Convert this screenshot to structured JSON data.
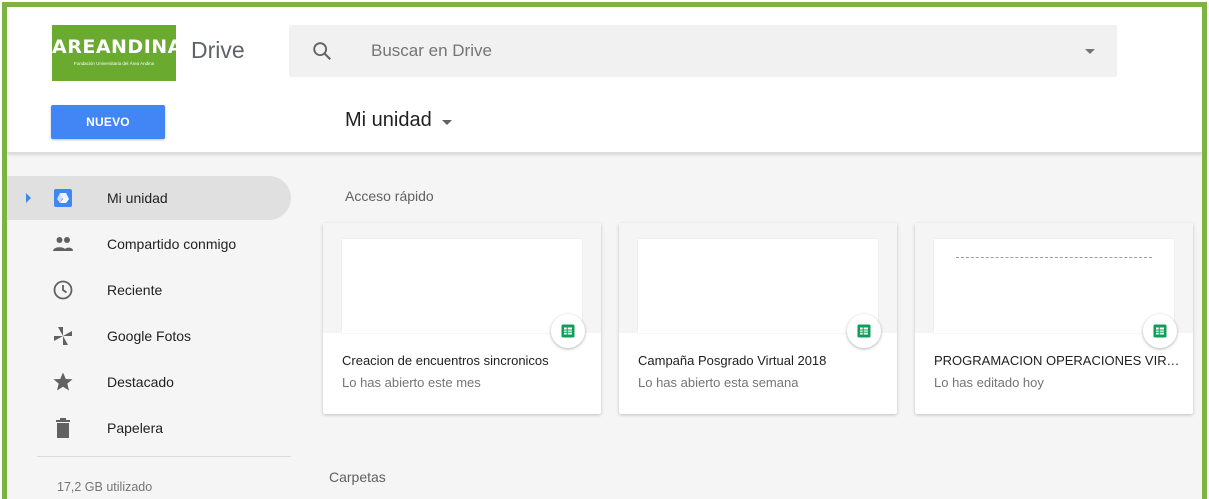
{
  "header": {
    "logo_text": "AREANDINA",
    "logo_subtext": "Fundación Universitaria del Área Andina",
    "app_title": "Drive",
    "search_placeholder": "Buscar en Drive",
    "new_button": "NUEVO",
    "location": "Mi unidad"
  },
  "sidebar": {
    "items": [
      {
        "label": "Mi unidad",
        "icon": "drive-icon",
        "active": true
      },
      {
        "label": "Compartido conmigo",
        "icon": "people-icon"
      },
      {
        "label": "Reciente",
        "icon": "clock-icon"
      },
      {
        "label": "Google Fotos",
        "icon": "pinwheel-icon"
      },
      {
        "label": "Destacado",
        "icon": "star-icon"
      },
      {
        "label": "Papelera",
        "icon": "trash-icon"
      }
    ],
    "storage": "17,2 GB utilizado"
  },
  "main": {
    "quick_access_title": "Acceso rápido",
    "folders_title": "Carpetas",
    "cards": [
      {
        "title": "Creacion de encuentros sincronicos",
        "subtitle": "Lo has abierto este mes",
        "type": "spreadsheet-icon"
      },
      {
        "title": "Campaña Posgrado Virtual 2018",
        "subtitle": "Lo has abierto esta semana",
        "type": "spreadsheet-icon"
      },
      {
        "title": "PROGRAMACION OPERACIONES VIRTUALES",
        "subtitle": "Lo has editado hoy",
        "type": "spreadsheet-icon"
      }
    ]
  },
  "colors": {
    "frame": "#7cb342",
    "logo_bg": "#6aaa2e",
    "primary": "#4285f4",
    "sheets": "#0f9d58"
  }
}
